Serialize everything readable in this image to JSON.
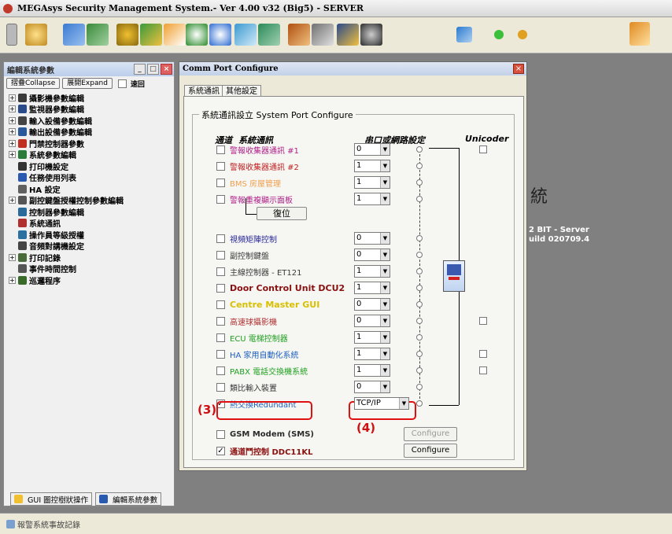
{
  "app": {
    "title": "MEGAsys Security Management System.- Ver 4.00 v32  (Big5) - SERVER"
  },
  "left_panel": {
    "title": "編輯系統參數",
    "collapse_label": "摺疊Collapse",
    "expand_label": "展開Expand",
    "speed_label": "速回",
    "tree": [
      {
        "label": "攝影機參數編輯",
        "expandable": true,
        "icon_color": "#3a3a3a"
      },
      {
        "label": "監視器參數編輯",
        "expandable": true,
        "icon_color": "#2a4a8a"
      },
      {
        "label": "輸入設備參數編輯",
        "expandable": true,
        "icon_color": "#444444"
      },
      {
        "label": "輸出設備參數編輯",
        "expandable": true,
        "icon_color": "#2a5a9a"
      },
      {
        "label": "門禁控制器參數",
        "expandable": true,
        "icon_color": "#c03020"
      },
      {
        "label": "系統參數編輯",
        "expandable": true,
        "icon_color": "#2a7a3a"
      },
      {
        "label": "打印機設定",
        "expandable": false,
        "icon_color": "#333333"
      },
      {
        "label": "任務使用列表",
        "expandable": false,
        "icon_color": "#2a5ab0"
      },
      {
        "label": "HA 設定",
        "expandable": false,
        "icon_color": "#606060"
      },
      {
        "label": "副控鍵盤授權控制參數編輯",
        "expandable": true,
        "icon_color": "#555555"
      },
      {
        "label": "控制器參數編輯",
        "expandable": false,
        "icon_color": "#2a6a9a"
      },
      {
        "label": "系統通訊",
        "expandable": false,
        "icon_color": "#b03030"
      },
      {
        "label": "操作員等級授權",
        "expandable": false,
        "icon_color": "#2a70a0"
      },
      {
        "label": "音頻對講機設定",
        "expandable": false,
        "icon_color": "#444444"
      },
      {
        "label": "打印記錄",
        "expandable": true,
        "icon_color": "#4a6a3a"
      },
      {
        "label": "事件時間控制",
        "expandable": false,
        "icon_color": "#555555"
      },
      {
        "label": "巡邏程序",
        "expandable": true,
        "icon_color": "#3a6a2a"
      }
    ],
    "bottom_tabs": [
      "GUI 圖控樹狀操作",
      "編輯系統參數"
    ]
  },
  "dialog": {
    "title": "Comm Port Configure",
    "tabs": [
      "系統通訊",
      "其他設定"
    ],
    "group_title": "系統通訊設立 System Port Configure",
    "headers": {
      "channel": "通道",
      "system_comm": "系統通訊",
      "serial_network": "串口或網路設定",
      "unicoder": "Unicoder"
    },
    "reset_label": "復位",
    "rows": [
      {
        "label": "警報收集器通訊 #1",
        "checked": false,
        "color": "#b0208a",
        "bold": false,
        "port": "0",
        "unicoder_checkbox": true
      },
      {
        "label": "警報收集器通訊 #2",
        "checked": false,
        "color": "#c02020",
        "bold": false,
        "port": "1",
        "unicoder_checkbox": false
      },
      {
        "label": "BMS 房屋管理",
        "checked": false,
        "color": "#f0a050",
        "bold": false,
        "port": "1",
        "unicoder_checkbox": false
      },
      {
        "label": "警報重複顯示面板",
        "checked": false,
        "color": "#b0208a",
        "bold": false,
        "port": "1",
        "unicoder_checkbox": false
      },
      {
        "label": "視頻矩陣控制",
        "checked": false,
        "color": "#2a2a9a",
        "bold": false,
        "port": "0",
        "unicoder_checkbox": false
      },
      {
        "label": "副控制鍵盤",
        "checked": false,
        "color": "#3a3a3a",
        "bold": false,
        "port": "0",
        "unicoder_checkbox": false
      },
      {
        "label": "主線控制器 - ET121",
        "checked": false,
        "color": "#3a3a3a",
        "bold": false,
        "port": "1",
        "unicoder_checkbox": false
      },
      {
        "label": "Door Control Unit DCU2",
        "checked": false,
        "color": "#8a1010",
        "bold": true,
        "port": "1",
        "unicoder_checkbox": false
      },
      {
        "label": "Centre Master GUI",
        "checked": false,
        "color": "#d8c000",
        "bold": true,
        "port": "0",
        "unicoder_checkbox": false
      },
      {
        "label": "高速球攝影機",
        "checked": false,
        "color": "#b03030",
        "bold": false,
        "port": "0",
        "unicoder_checkbox": true
      },
      {
        "label": "ECU 電梯控制器",
        "checked": false,
        "color": "#20a020",
        "bold": false,
        "port": "1",
        "unicoder_checkbox": false
      },
      {
        "label": "HA 家用自動化系統",
        "checked": false,
        "color": "#2060c0",
        "bold": false,
        "port": "1",
        "unicoder_checkbox": true
      },
      {
        "label": "PABX 電話交換機系統",
        "checked": false,
        "color": "#20a020",
        "bold": false,
        "port": "1",
        "unicoder_checkbox": true
      },
      {
        "label": "類比輸入裝置",
        "checked": false,
        "color": "#3a3a3a",
        "bold": false,
        "port": "0",
        "unicoder_checkbox": false
      },
      {
        "label": "熱交換Redundant",
        "checked": true,
        "color": "#2060c0",
        "bold": false,
        "port": "TCP/IP",
        "unicoder_checkbox": false
      }
    ],
    "gsm_row": {
      "label": "GSM Modem (SMS)",
      "checked": false,
      "button": "Configure"
    },
    "ddc_row": {
      "label": "通道鬥控制 DDC11KL",
      "checked": true,
      "button": "Configure"
    }
  },
  "annotations": {
    "a3": "(3)",
    "a4": "(4)"
  },
  "background_text": {
    "char": "統",
    "line1": "2 BIT - Server",
    "line2": "uild 020709.4"
  },
  "status_bar": {
    "text": "報警系統事故記錄"
  }
}
